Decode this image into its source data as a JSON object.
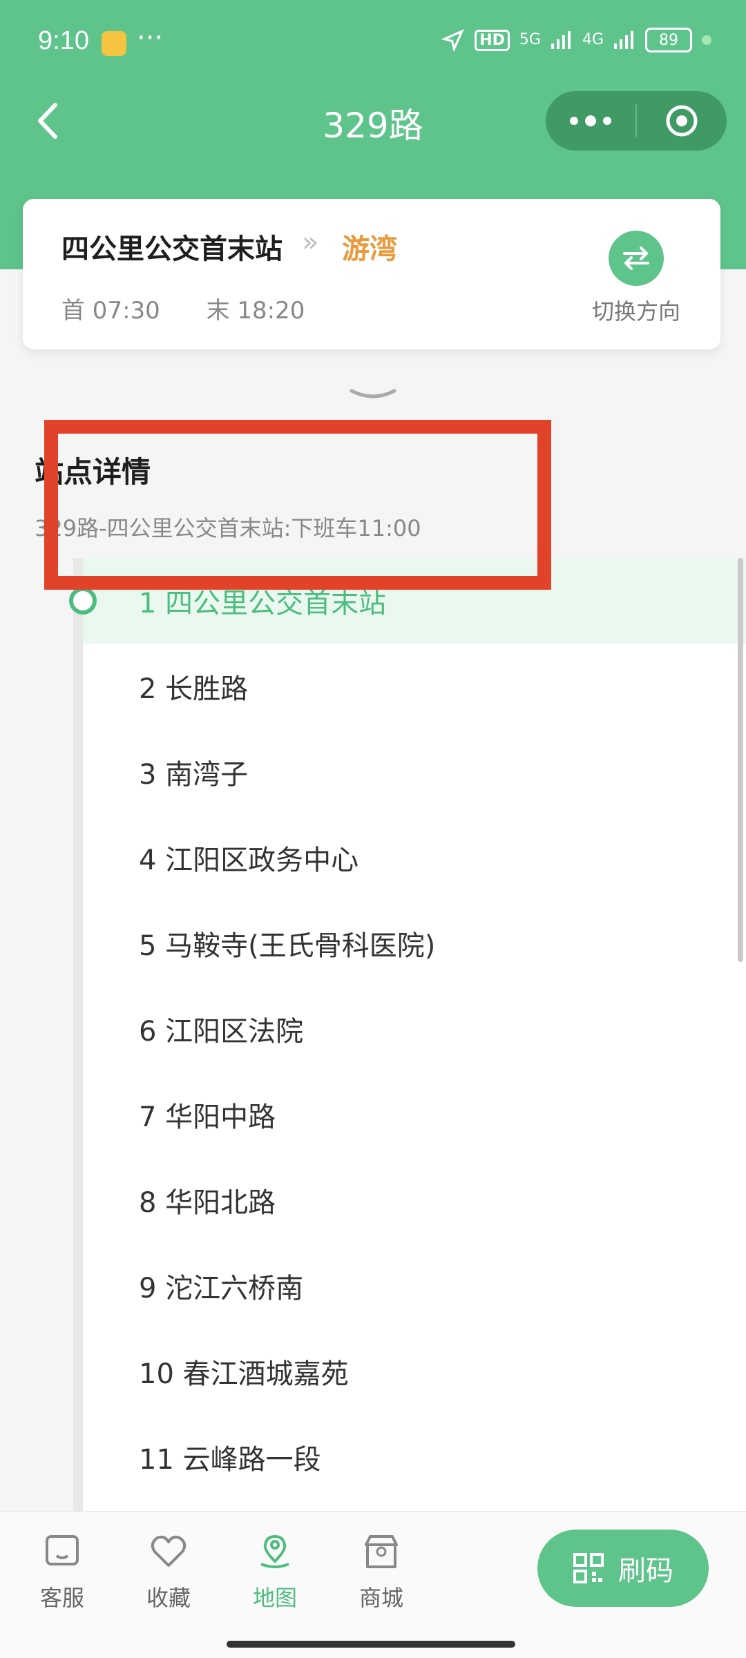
{
  "status": {
    "time": "9:10",
    "dots": "···",
    "hd": "HD",
    "sig5g": "5G",
    "sig4g": "4G",
    "battery": "89"
  },
  "nav": {
    "title": "329路"
  },
  "route": {
    "from": "四公里公交首末站",
    "chev": "»",
    "to": "游湾",
    "first": "首 07:30",
    "last": "末 18:20",
    "switch_label": "切换方向"
  },
  "details": {
    "title": "站点详情",
    "notice": "329路-四公里公交首末站:下班车11:00"
  },
  "stops": [
    "1 四公里公交首末站",
    "2 长胜路",
    "3 南湾子",
    "4 江阳区政务中心",
    "5 马鞍寺(王氏骨科医院)",
    "6 江阳区法院",
    "7 华阳中路",
    "8 华阳北路",
    "9 沱江六桥南",
    "10 春江酒城嘉苑",
    "11 云峰路一段"
  ],
  "tabs": {
    "service": "客服",
    "favorite": "收藏",
    "map": "地图",
    "mall": "商城"
  },
  "scan_label": "刷码",
  "colors": {
    "primary": "#5ec48b",
    "accent": "#e89a3d",
    "highlight": "#e0432a"
  }
}
